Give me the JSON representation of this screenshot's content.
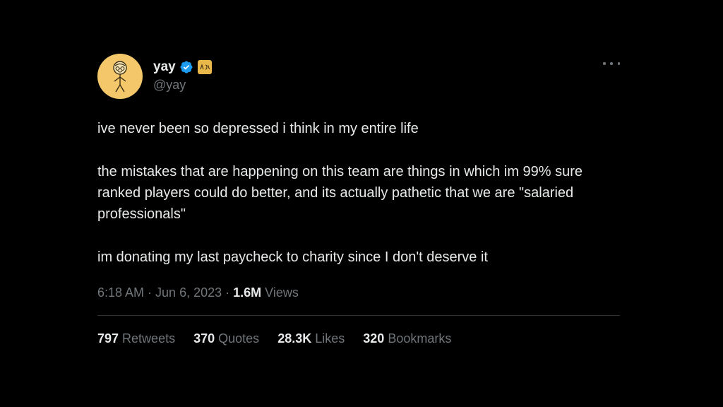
{
  "tweet": {
    "author": {
      "display_name": "yay",
      "handle": "@yay",
      "avatar_icon": "stick-figure-avatar",
      "verified_icon": "verified-badge-icon",
      "affiliation_icon": "affiliate-badge-icon"
    },
    "more_icon": "more-options-icon",
    "body": {
      "p1": "ive never been so depressed i think in my entire life",
      "p2": "the mistakes that are happening on this team are things in which im 99% sure ranked players could do better, and its actually pathetic that we are \"salaried professionals\"",
      "p3": "im donating my last paycheck to charity since I don't deserve it"
    },
    "meta": {
      "time": "6:18 AM",
      "sep1": " · ",
      "date": "Jun 6, 2023",
      "sep2": " · ",
      "views_count": "1.6M",
      "views_label": " Views"
    },
    "stats": {
      "retweets": {
        "count": "797",
        "label": " Retweets"
      },
      "quotes": {
        "count": "370",
        "label": " Quotes"
      },
      "likes": {
        "count": "28.3K",
        "label": " Likes"
      },
      "bookmarks": {
        "count": "320",
        "label": " Bookmarks"
      }
    }
  },
  "colors": {
    "background": "#000000",
    "text_primary": "#e7e9ea",
    "text_secondary": "#71767b",
    "verified_blue": "#1d9bf0",
    "avatar_bg": "#f3c76a",
    "divider": "#2f3336"
  }
}
